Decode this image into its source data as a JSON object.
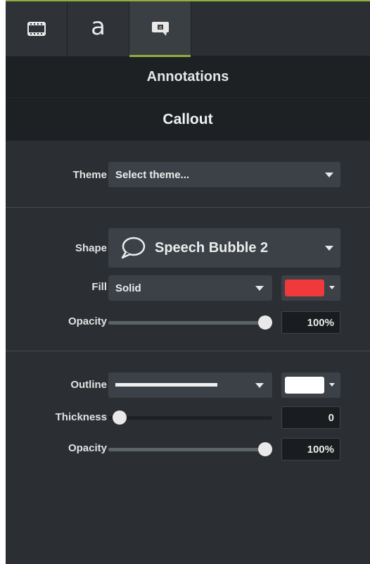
{
  "tabs": [
    {
      "name": "media",
      "icon": "film-strip-icon"
    },
    {
      "name": "text",
      "label": "a"
    },
    {
      "name": "annotations",
      "icon": "callout-icon",
      "active": true
    }
  ],
  "section_title": "Annotations",
  "subsection_title": "Callout",
  "theme": {
    "label": "Theme",
    "value": "Select theme..."
  },
  "shape": {
    "label": "Shape",
    "value": "Speech Bubble 2",
    "icon": "speech-bubble-icon"
  },
  "fill": {
    "label": "Fill",
    "value": "Solid",
    "color": "#f0393b"
  },
  "fill_opacity": {
    "label": "Opacity",
    "value": "100%",
    "level": 1.0
  },
  "outline": {
    "label": "Outline",
    "style": "solid-line",
    "color": "#ffffff"
  },
  "thickness": {
    "label": "Thickness",
    "value": "0",
    "level": 0.0
  },
  "outline_opacity": {
    "label": "Opacity",
    "value": "100%",
    "level": 1.0
  },
  "colors": {
    "accent": "#8fae3c",
    "panel": "#2b2f33",
    "header": "#1d2124"
  }
}
